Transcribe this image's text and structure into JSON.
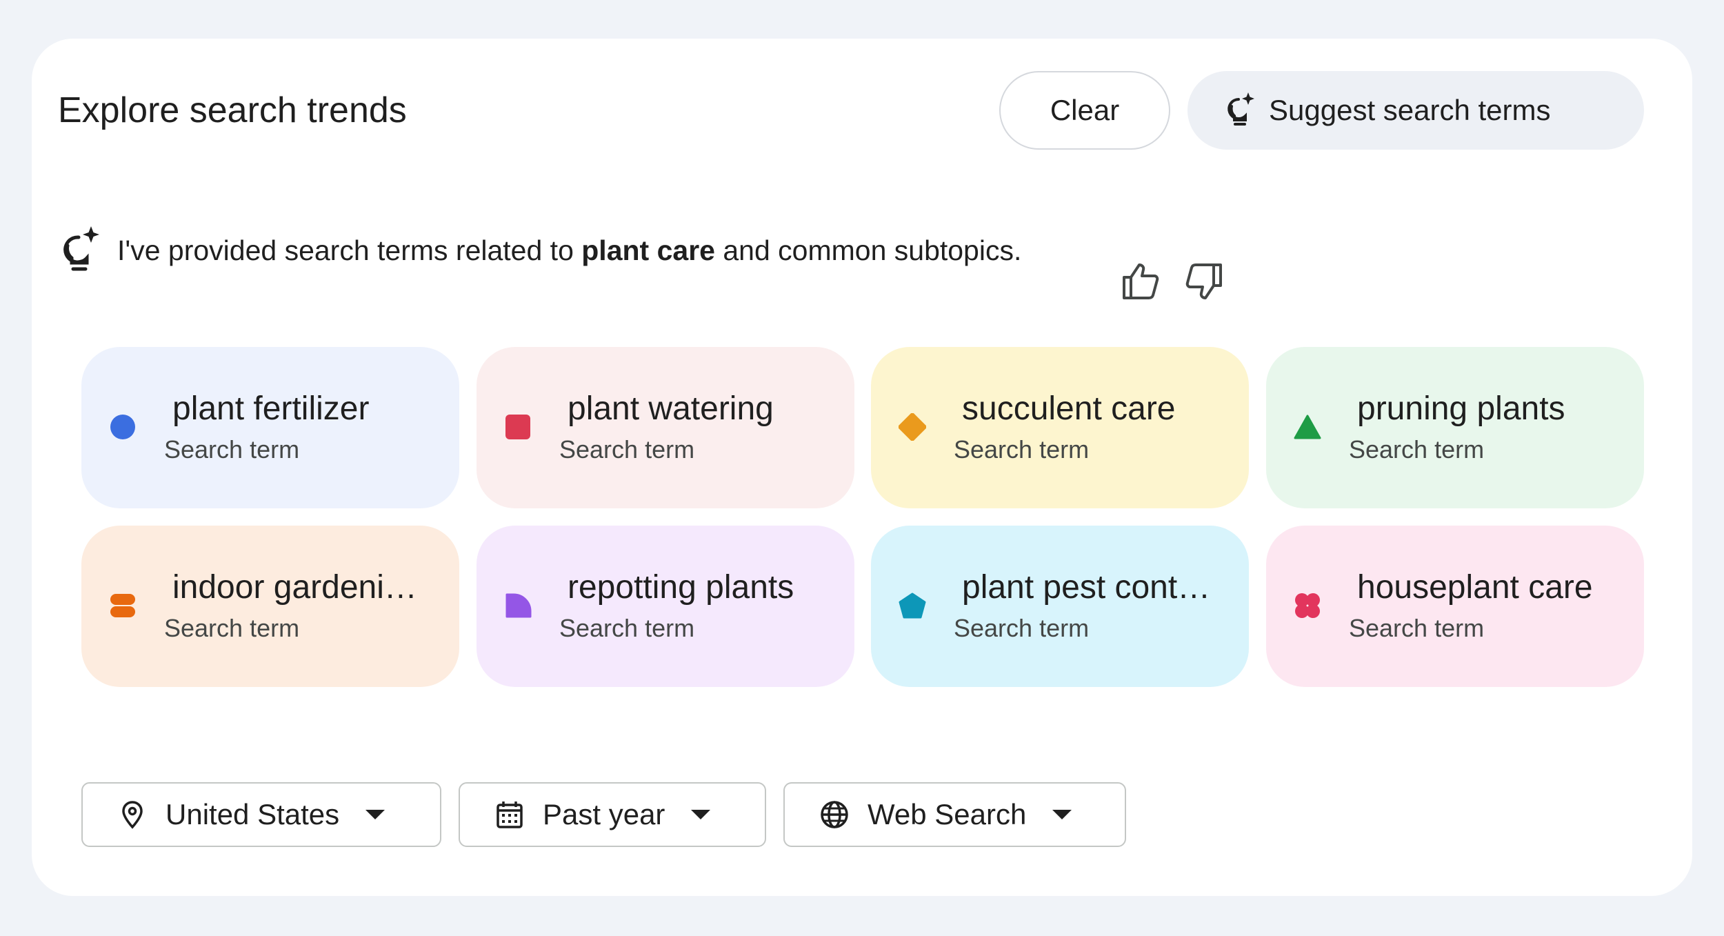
{
  "header": {
    "title": "Explore search trends",
    "clear_label": "Clear",
    "suggest_label": "Suggest search terms"
  },
  "ai_message": {
    "prefix": "I've provided search terms related to ",
    "topic": "plant care",
    "suffix": " and common subtopics."
  },
  "terms": [
    {
      "term": "plant fertilizer",
      "type": "Search term",
      "bg": "#edf2fd",
      "color": "#3b6ee0",
      "shape": "circle"
    },
    {
      "term": "plant watering",
      "type": "Search term",
      "bg": "#fbeeee",
      "color": "#dc3a52",
      "shape": "square"
    },
    {
      "term": "succulent care",
      "type": "Search term",
      "bg": "#fdf5cf",
      "color": "#ea9a1d",
      "shape": "diamond"
    },
    {
      "term": "pruning plants",
      "type": "Search term",
      "bg": "#e8f7ec",
      "color": "#1e9c45",
      "shape": "triangle"
    },
    {
      "term": "indoor gardeni…",
      "type": "Search term",
      "bg": "#fdecdf",
      "color": "#e8690f",
      "shape": "pill-stack"
    },
    {
      "term": "repotting plants",
      "type": "Search term",
      "bg": "#f5e9fd",
      "color": "#9456e6",
      "shape": "quarter"
    },
    {
      "term": "plant pest cont…",
      "type": "Search term",
      "bg": "#d8f4fc",
      "color": "#0d97b8",
      "shape": "pentagon"
    },
    {
      "term": "houseplant care",
      "type": "Search term",
      "bg": "#fde7f1",
      "color": "#e2355d",
      "shape": "flower"
    }
  ],
  "filters": {
    "location": "United States",
    "time": "Past year",
    "property": "Web Search"
  }
}
